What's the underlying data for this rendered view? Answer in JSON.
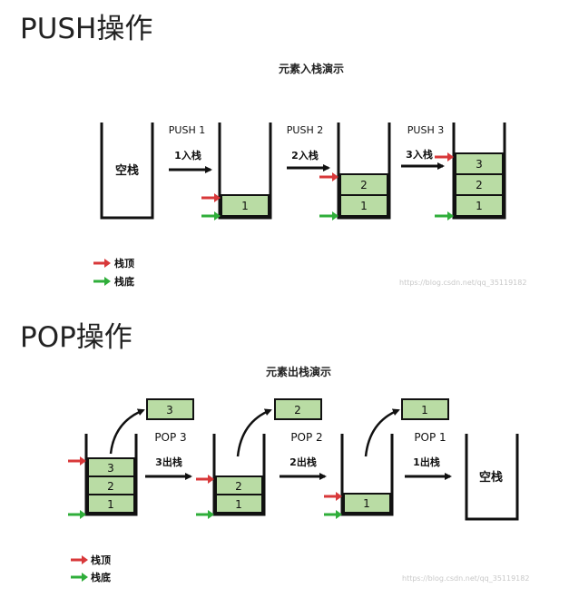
{
  "push_section": {
    "title": "PUSH操作",
    "diagram_title": "元素入栈演示",
    "empty_label": "空栈",
    "steps": [
      {
        "op": "PUSH 1",
        "action": "1入栈",
        "items": [
          "1"
        ]
      },
      {
        "op": "PUSH 2",
        "action": "2入栈",
        "items": [
          "1",
          "2"
        ]
      },
      {
        "op": "PUSH 3",
        "action": "3入栈",
        "items": [
          "1",
          "2",
          "3"
        ]
      }
    ],
    "legend": {
      "top": "栈顶",
      "bottom": "栈底"
    },
    "watermark": "https://blog.csdn.net/qq_35119182"
  },
  "pop_section": {
    "title": "POP操作",
    "diagram_title": "元素出栈演示",
    "empty_label": "空栈",
    "steps": [
      {
        "op": "POP 3",
        "action": "3出栈",
        "popped": "3",
        "items": [
          "1",
          "2",
          "3"
        ]
      },
      {
        "op": "POP 2",
        "action": "2出栈",
        "popped": "2",
        "items": [
          "1",
          "2"
        ]
      },
      {
        "op": "POP 1",
        "action": "1出栈",
        "popped": "1",
        "items": [
          "1"
        ]
      }
    ],
    "legend": {
      "top": "栈顶",
      "bottom": "栈底"
    },
    "watermark": "https://blog.csdn.net/qq_35119182"
  },
  "colors": {
    "box_fill": "#b9dca4",
    "top_arrow": "#d8383a",
    "bottom_arrow": "#2fae3a",
    "stroke": "#111111"
  }
}
